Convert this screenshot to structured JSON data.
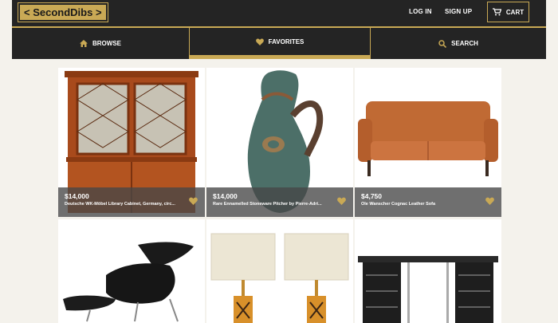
{
  "header": {
    "logo": "< SecondDibs >",
    "login": "LOG IN",
    "signup": "SIGN UP",
    "cart": "CART"
  },
  "tabs": [
    {
      "label": "BROWSE",
      "icon": "home-icon"
    },
    {
      "label": "FAVORITES",
      "icon": "heart-icon",
      "active": true
    },
    {
      "label": "SEARCH",
      "icon": "search-icon"
    }
  ],
  "products": [
    {
      "price": "$14,000",
      "title": "Deutsche WK-Möbel Library Cabinet, Germany, circ..."
    },
    {
      "price": "$14,000",
      "title": "Rare Ennamelled Stoneware Pitcher by Pierre-Adri..."
    },
    {
      "price": "$4,750",
      "title": "Ole Wanscher Cognac Leather Sofa"
    },
    {
      "price": "",
      "title": ""
    },
    {
      "price": "",
      "title": ""
    },
    {
      "price": "",
      "title": ""
    }
  ],
  "colors": {
    "accent": "#c9a955",
    "bar": "#242424",
    "page": "#f4f2ec"
  }
}
